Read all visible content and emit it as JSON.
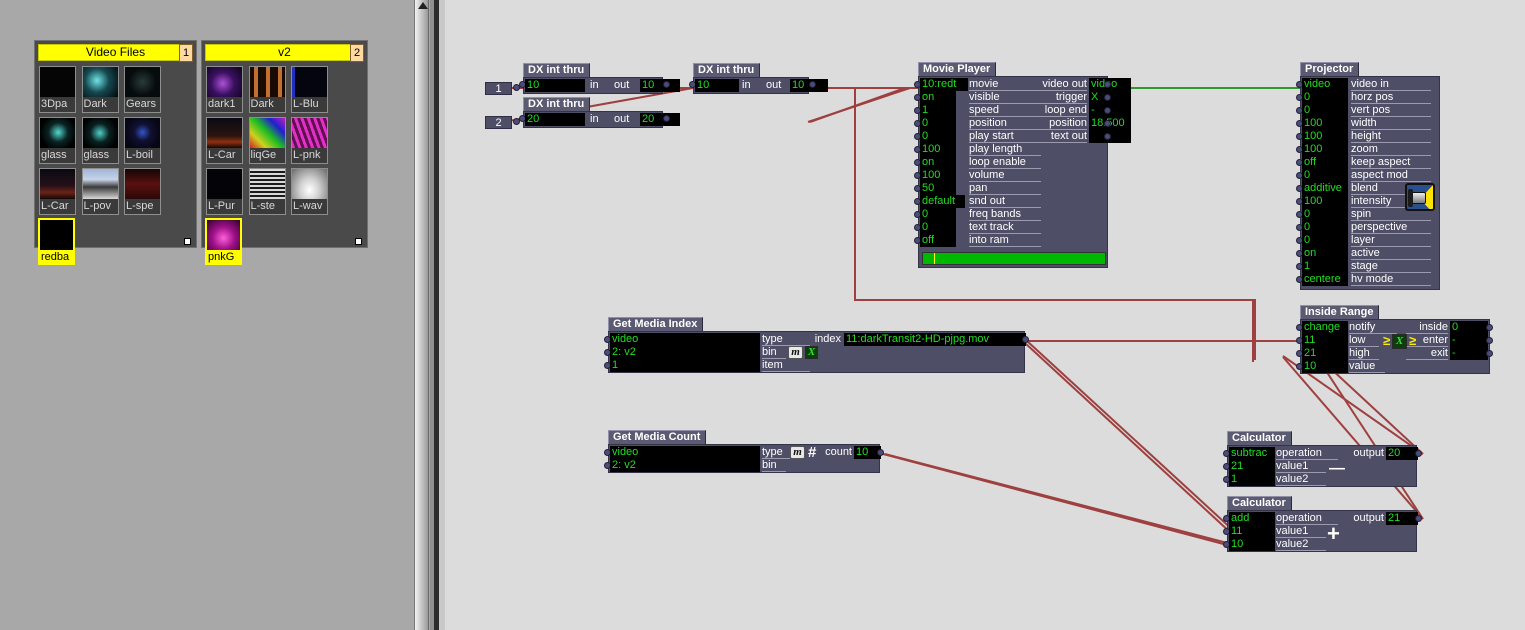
{
  "app": {
    "background": "#dcdcdc",
    "bin_background": "#a8a8a8",
    "accent_yellow": "#ffff00",
    "node_body": "#4e4e66",
    "node_title": "#5a5a72",
    "value_green": "#22dd22",
    "wire_red": "#9e4040",
    "wire_green": "#2e9a2e"
  },
  "bins": [
    {
      "name": "Video Files",
      "number": "1",
      "items": [
        {
          "label": "3Dpa",
          "selected": false
        },
        {
          "label": "Dark",
          "selected": false
        },
        {
          "label": "Gears",
          "selected": false
        },
        {
          "label": "glass",
          "selected": false
        },
        {
          "label": "glass",
          "selected": false
        },
        {
          "label": "L-boil",
          "selected": false
        },
        {
          "label": "L-Car",
          "selected": false
        },
        {
          "label": "L-pov",
          "selected": false
        },
        {
          "label": "L-spe",
          "selected": false
        },
        {
          "label": "redba",
          "selected": true
        }
      ]
    },
    {
      "name": "v2",
      "number": "2",
      "items": [
        {
          "label": "dark1",
          "selected": false
        },
        {
          "label": "Dark",
          "selected": false
        },
        {
          "label": "L-Blu",
          "selected": false
        },
        {
          "label": "L-Car",
          "selected": false
        },
        {
          "label": "liqGe",
          "selected": false
        },
        {
          "label": "L-pnk",
          "selected": false
        },
        {
          "label": "L-Pur",
          "selected": false
        },
        {
          "label": "L-ste",
          "selected": false
        },
        {
          "label": "L-wav",
          "selected": false
        },
        {
          "label": "pnkG",
          "selected": true
        }
      ]
    }
  ],
  "patch": {
    "inputs": [
      {
        "label": "1"
      },
      {
        "label": "2"
      }
    ],
    "nodes": {
      "dx_int_thru_1": {
        "title": "DX int thru",
        "value_in": "10",
        "label_in": "in",
        "label_out": "out",
        "value_out": "10"
      },
      "dx_int_thru_2": {
        "title": "DX int thru",
        "value_in": "20",
        "label_in": "in",
        "label_out": "out",
        "value_out": "20"
      },
      "dx_int_thru_3": {
        "title": "DX int thru",
        "value_in": "10",
        "label_in": "in",
        "label_out": "out",
        "value_out": "10"
      },
      "movie_player": {
        "title": "Movie Player",
        "inputs": [
          {
            "value": "10:redt",
            "label": "movie"
          },
          {
            "value": "on",
            "label": "visible"
          },
          {
            "value": "1",
            "label": "speed"
          },
          {
            "value": "0",
            "label": "position"
          },
          {
            "value": "0",
            "label": "play start"
          },
          {
            "value": "100",
            "label": "play length"
          },
          {
            "value": "on",
            "label": "loop enable"
          },
          {
            "value": "100",
            "label": "volume"
          },
          {
            "value": "50",
            "label": "pan"
          },
          {
            "value": "default",
            "label": "snd out"
          },
          {
            "value": "0",
            "label": "freq bands"
          },
          {
            "value": "0",
            "label": "text track"
          },
          {
            "value": "off",
            "label": "into ram"
          }
        ],
        "outputs": [
          {
            "label": "video out",
            "value": "video"
          },
          {
            "label": "trigger",
            "value": "X"
          },
          {
            "label": "loop end",
            "value": "-"
          },
          {
            "label": "position",
            "value": "18.500"
          },
          {
            "label": "text out",
            "value": ""
          }
        ],
        "progress_percent": 6
      },
      "projector": {
        "title": "Projector",
        "icon": "projector-icon",
        "inputs": [
          {
            "value": "video",
            "label": "video in"
          },
          {
            "value": "0",
            "label": "horz pos"
          },
          {
            "value": "0",
            "label": "vert pos"
          },
          {
            "value": "100",
            "label": "width"
          },
          {
            "value": "100",
            "label": "height"
          },
          {
            "value": "100",
            "label": "zoom"
          },
          {
            "value": "off",
            "label": "keep aspect"
          },
          {
            "value": "0",
            "label": "aspect mod"
          },
          {
            "value": "additive",
            "label": "blend"
          },
          {
            "value": "100",
            "label": "intensity"
          },
          {
            "value": "0",
            "label": "spin"
          },
          {
            "value": "0",
            "label": "perspective"
          },
          {
            "value": "0",
            "label": "layer"
          },
          {
            "value": "on",
            "label": "active"
          },
          {
            "value": "1",
            "label": "stage"
          },
          {
            "value": "centere",
            "label": "hv mode"
          }
        ]
      },
      "get_media_index": {
        "title": "Get Media Index",
        "inputs": [
          {
            "value": "video",
            "label": "type"
          },
          {
            "value": "2: v2",
            "label": "bin"
          },
          {
            "value": "1",
            "label": "item"
          }
        ],
        "output_label": "index",
        "output_value": "11:darkTransit2-HD-pjpg.mov",
        "icon_m": "m",
        "icon_x": "X"
      },
      "get_media_count": {
        "title": "Get Media Count",
        "inputs": [
          {
            "value": "video",
            "label": "type"
          },
          {
            "value": "2: v2",
            "label": "bin"
          }
        ],
        "output_label": "count",
        "output_value": "10",
        "icon_m": "m",
        "icon_hash": "#"
      },
      "inside_range": {
        "title": "Inside Range",
        "inputs": [
          {
            "value": "change",
            "label": "notify"
          },
          {
            "value": "11",
            "label": "low"
          },
          {
            "value": "21",
            "label": "high"
          },
          {
            "value": "10",
            "label": "value"
          }
        ],
        "outputs": [
          {
            "label": "inside",
            "value": "0"
          },
          {
            "label": "enter",
            "value": "-"
          },
          {
            "label": "exit",
            "value": "-"
          }
        ],
        "glyph_left": "≥",
        "glyph_center": "X",
        "glyph_right": "≥"
      },
      "calculator_subtract": {
        "title": "Calculator",
        "inputs": [
          {
            "value": "subtrac",
            "label": "operation"
          },
          {
            "value": "21",
            "label": "value1"
          },
          {
            "value": "1",
            "label": "value2"
          }
        ],
        "output_label": "output",
        "output_value": "20",
        "op_glyph": "—"
      },
      "calculator_add": {
        "title": "Calculator",
        "inputs": [
          {
            "value": "add",
            "label": "operation"
          },
          {
            "value": "11",
            "label": "value1"
          },
          {
            "value": "10",
            "label": "value2"
          }
        ],
        "output_label": "output",
        "output_value": "21",
        "op_glyph": "+"
      }
    }
  }
}
